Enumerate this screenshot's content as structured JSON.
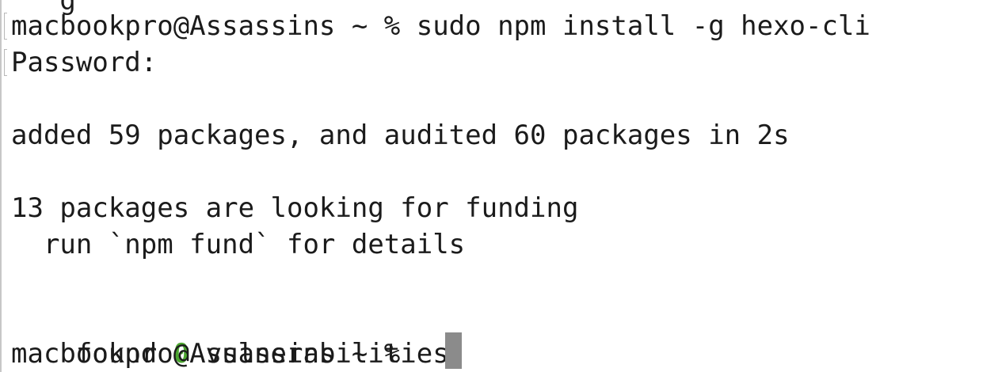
{
  "terminal": {
    "clipped_top_line": "   g",
    "lines": [
      {
        "text": "macbookpro@Assassins ~ % sudo npm install -g hexo-cli"
      },
      {
        "text": "Password:"
      },
      {
        "text": ""
      },
      {
        "text": "added 59 packages, and audited 60 packages in 2s"
      },
      {
        "text": ""
      },
      {
        "text": "13 packages are looking for funding"
      },
      {
        "text": "  run `npm fund` for details"
      },
      {
        "text": ""
      },
      {
        "before": "found ",
        "highlight": "0",
        "after": " vulnerabilities"
      },
      {
        "text": "macbookpro@Assassins ~ % "
      }
    ],
    "colors": {
      "background": "#ffffff",
      "text": "#1b1b1b",
      "highlight": "#4aa52f",
      "cursor": "#8b8b8b"
    }
  }
}
